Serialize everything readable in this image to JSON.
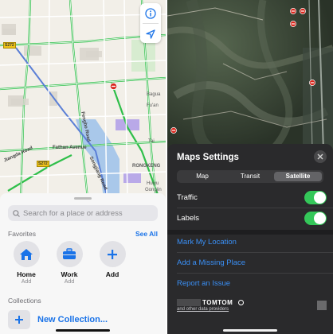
{
  "colors": {
    "accent": "#1a73e8",
    "toggle_on": "#34c759",
    "link_dark": "#3a8ff5"
  },
  "left_panel": {
    "map": {
      "labels": {
        "road_name_1": "Fathan Avenue",
        "road_name_2": "Fengbo Road",
        "road_name_3": "Jiangda Road",
        "road_name_4": "Songjiang Road",
        "district": "RONGKENG",
        "place_1": "Bagua",
        "place_2": "Fu'an",
        "place_3": "Tai",
        "place_4": "Huiyu",
        "place_5": "Gongjin"
      },
      "route_badges": [
        "S272",
        "S272"
      ],
      "controls": {
        "info_icon": "info-icon",
        "location_icon": "location-arrow-icon"
      }
    },
    "sheet": {
      "search_placeholder": "Search for a place or address",
      "favorites_title": "Favorites",
      "see_all": "See All",
      "favorites": [
        {
          "name": "Home",
          "sub": "Add",
          "icon": "house-icon"
        },
        {
          "name": "Work",
          "sub": "Add",
          "icon": "briefcase-icon"
        },
        {
          "name": "Add",
          "sub": "",
          "icon": "plus-icon"
        }
      ],
      "collections_title": "Collections",
      "new_collection": "New Collection..."
    }
  },
  "right_panel": {
    "settings": {
      "title": "Maps Settings",
      "tabs": [
        {
          "label": "Map",
          "active": false
        },
        {
          "label": "Transit",
          "active": false
        },
        {
          "label": "Satellite",
          "active": true
        }
      ],
      "toggles": [
        {
          "label": "Traffic",
          "on": true
        },
        {
          "label": "Labels",
          "on": true
        }
      ],
      "links": [
        "Mark My Location",
        "Add a Missing Place",
        "Report an Issue"
      ],
      "footer": {
        "brand": "TOMTOM",
        "providers": "and other data providers"
      }
    }
  }
}
